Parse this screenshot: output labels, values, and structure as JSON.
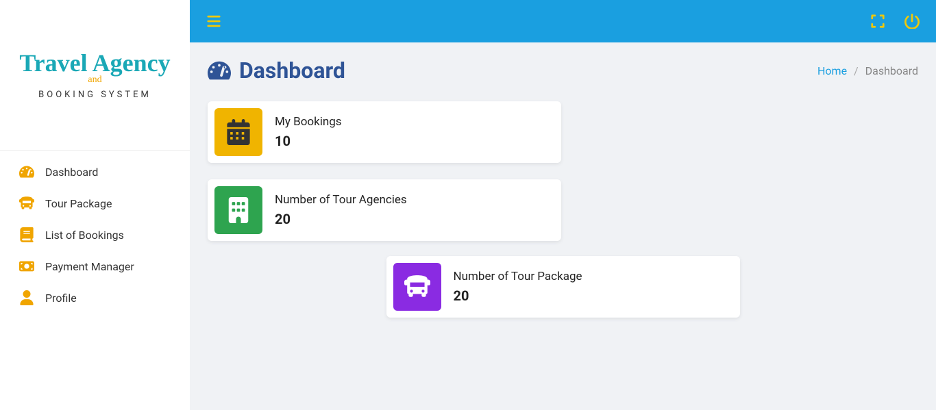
{
  "brand": {
    "line1": "Travel Agency",
    "line2": "and",
    "line3": "BOOKING SYSTEM"
  },
  "sidebar": {
    "items": [
      {
        "label": "Dashboard"
      },
      {
        "label": "Tour Package"
      },
      {
        "label": "List of Bookings"
      },
      {
        "label": "Payment Manager"
      },
      {
        "label": "Profile"
      }
    ]
  },
  "page": {
    "title": "Dashboard"
  },
  "breadcrumb": {
    "home": "Home",
    "current": "Dashboard",
    "sep": "/"
  },
  "cards": {
    "bookings": {
      "title": "My Bookings",
      "value": "10"
    },
    "agencies": {
      "title": "Number of Tour Agencies",
      "value": "20"
    },
    "packages": {
      "title": "Number of Tour Package",
      "value": "20"
    }
  }
}
